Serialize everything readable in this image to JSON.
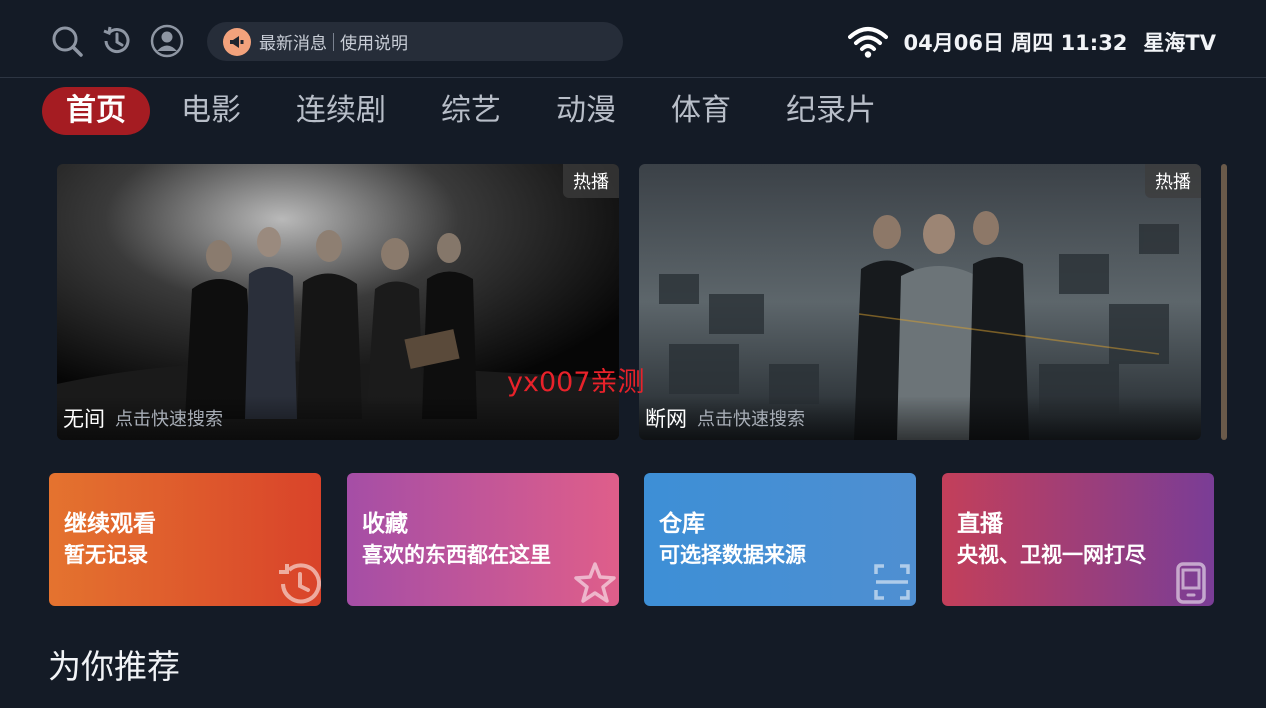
{
  "header": {
    "icons": [
      "search-icon",
      "history-icon",
      "user-icon"
    ],
    "notice": {
      "icon": "megaphone-icon",
      "news": "最新消息",
      "guide": "使用说明"
    },
    "clock": "04月06日 周四 11:32",
    "brand": "星海TV"
  },
  "tabs": [
    "首页",
    "电影",
    "连续剧",
    "综艺",
    "动漫",
    "体育",
    "纪录片"
  ],
  "banners": [
    {
      "title": "无间",
      "hint": "点击快速搜索",
      "tag": "热播"
    },
    {
      "title": "断网",
      "hint": "点击快速搜索",
      "tag": "热播"
    }
  ],
  "watermark": "yx007亲测",
  "cards": [
    {
      "title": "继续观看",
      "subtitle": "暂无记录",
      "icon": "history-icon",
      "colors": [
        "#e4732f",
        "#d9432a"
      ]
    },
    {
      "title": "收藏",
      "subtitle": "喜欢的东西都在这里",
      "icon": "star-icon",
      "colors": [
        "#a54ea6",
        "#df5e8a"
      ]
    },
    {
      "title": "仓库",
      "subtitle": "可选择数据来源",
      "icon": "warehouse-icon",
      "colors": [
        "#3d8fd6",
        "#4f8fd1"
      ]
    },
    {
      "title": "直播",
      "subtitle": "央视、卫视一网打尽",
      "icon": "tv-icon",
      "colors": [
        "#c33f5a",
        "#7a3d96"
      ]
    }
  ],
  "section": {
    "title": "为你推荐"
  }
}
